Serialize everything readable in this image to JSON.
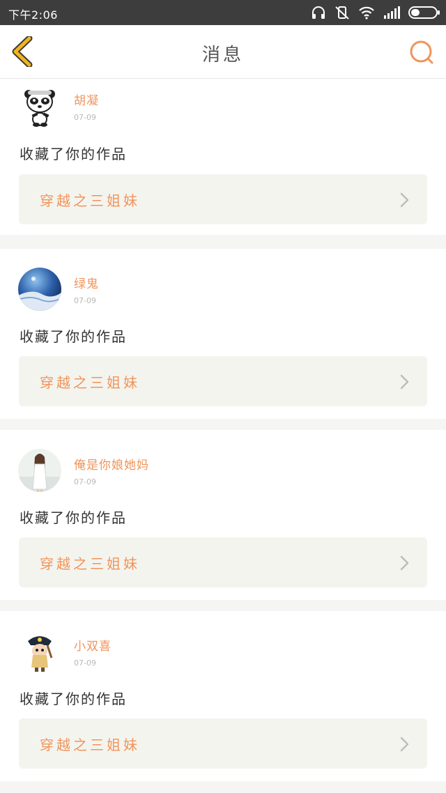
{
  "status_bar": {
    "time": "下午2:06",
    "icons": [
      "headphones-icon",
      "mute-vibrate-icon",
      "wifi-icon",
      "signal-icon",
      "battery-icon"
    ]
  },
  "header": {
    "title": "消息",
    "back_icon": "chevron-left-icon",
    "search_icon": "search-icon"
  },
  "colors": {
    "accent": "#f0945a",
    "back_arrow": "#f2b41d",
    "card_bg": "#ffffff",
    "work_bg": "#f4f4ef",
    "page_bg": "#f5f5f3",
    "status_bar_bg": "#3d3d3d"
  },
  "messages": [
    {
      "username": "胡凝",
      "date": "07-09",
      "action": "收藏了你的作品",
      "work_title": "穿越之三姐妹",
      "avatar": "panda-avatar"
    },
    {
      "username": "绿鬼",
      "date": "07-09",
      "action": "收藏了你的作品",
      "work_title": "穿越之三姐妹",
      "avatar": "earth-avatar"
    },
    {
      "username": "俺是你娘她妈",
      "date": "07-09",
      "action": "收藏了你的作品",
      "work_title": "穿越之三姐妹",
      "avatar": "girl-photo-avatar"
    },
    {
      "username": "小双喜",
      "date": "07-09",
      "action": "收藏了你的作品",
      "work_title": "穿越之三姐妹",
      "avatar": "pirate-avatar"
    }
  ]
}
